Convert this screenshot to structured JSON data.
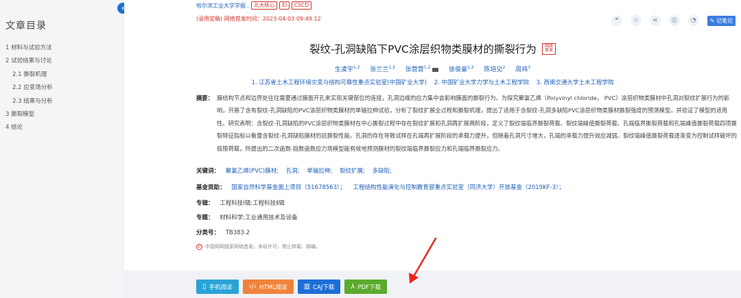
{
  "sidebar": {
    "title": "文章目录",
    "items": [
      {
        "label": "1 材料与试验方法",
        "level": 1
      },
      {
        "label": "2 试验结果与讨论",
        "level": 1
      },
      {
        "label": "2.1 撕裂机理",
        "level": 2
      },
      {
        "label": "2.2 应变场分析",
        "level": 2
      },
      {
        "label": "2.3 结果与分析",
        "level": 2
      },
      {
        "label": "3 撕裂模型",
        "level": 1
      },
      {
        "label": "4 结论",
        "level": 1
      }
    ],
    "collapse_icon": "chevron-left-icon"
  },
  "header": {
    "source": "哈尔滨工业大学学报 .",
    "badges": [
      "北大核心",
      "EI",
      "CSCD"
    ],
    "publish": "(录用定稿) 网络首发时间：2023-04-03 09:49:12",
    "tools": [
      "quote-icon",
      "star-icon",
      "share-icon",
      "print-icon",
      "bell-icon"
    ],
    "note_label": "记笔记"
  },
  "article": {
    "title": "裂纹-孔洞缺陷下PVC涂层织物类膜材的撕裂行为",
    "title_badge": "网络首发",
    "authors": [
      {
        "name": "生凌宇",
        "sup": "1,2"
      },
      {
        "name": "张兰兰",
        "sup": "1,2"
      },
      {
        "name": "张营营",
        "sup": "1,2"
      },
      {
        "name": "徐俊豪",
        "sup": "1,2"
      },
      {
        "name": "陈培见",
        "sup": "2"
      },
      {
        "name": "周祎",
        "sup": "3"
      }
    ],
    "affiliations": [
      "1. 江苏省土木工程环境灾变与结构可靠性重点实验室(中国矿业大学)",
      "2. 中国矿业大学力学与土木工程学院",
      "3. 西南交通大学土木工程学院"
    ],
    "abstract_label": "摘要：",
    "abstract": "膜结构节点和边界处往往需要通过膜面开孔来实现关键部位的连接，孔洞边缘的应力集中会影响膜面的撕裂行为。为探究聚氯乙烯（Polyvinyl chloride， PVC）涂层织物类膜材中孔洞对裂纹扩展行为的影响，开展了含有裂纹-孔洞缺陷的PVC涂层织物类膜材的单轴拉伸试验，分析了裂纹扩展全过程和撕裂机理，提出了适用于含裂纹-孔洞多缺陷PVC涂层织物类膜材撕裂强度的预测模型，并验证了模型的适用性。研究表明：含裂纹-孔洞缺陷的PVC涂层织物类膜材在中心撕裂过程中存在裂纹扩展和孔洞再扩展两阶段，定义了裂纹端临界撕裂荷载、裂纹端峰值撕裂荷载、孔端临界撕裂荷载和孔端峰值撕裂荷载四项撕裂特征指标以衡量含裂纹-孔洞缺陷膜材的抗撕裂性能。孔洞的存在导致试样在孔端再扩展阶段的承载力提升，但随着孔洞尺寸增大，孔端的承载力提升效应减弱。裂纹端峰值撕裂荷载逐渐变为控制试样破坏的极限荷载，所提出的二次函数-指数函数应力场模型能有效地预测膜材的裂纹端临界撕裂应力和孔端临界撕裂应力。",
    "keywords_label": "关键词：",
    "keywords": [
      "聚氯乙烯(PVC)膜材;",
      "孔洞;",
      "单轴拉伸;",
      "裂纹扩展;",
      "多缺陷;"
    ],
    "fund_label": "基金资助：",
    "funds": [
      "国家自然科学基金面上项目（51678563）；",
      "工程结构性能演化与控制教育部重点实验室（同济大学）开放基金（2019KF-3）；"
    ],
    "series_label": "专辑：",
    "series": "工程科技Ⅰ辑;工程科技Ⅱ辑",
    "topic_label": "专题：",
    "topic": "材料科学;工业通用技术及设备",
    "class_label": "分类号：",
    "class_no": "TB383.2",
    "notice": "中国知网独家网络首发，未经许可，禁止转载、摘编。"
  },
  "downloads": [
    {
      "label": "手机阅读",
      "icon": "phone-icon"
    },
    {
      "label": "HTML阅读",
      "icon": "code-icon"
    },
    {
      "label": "CAJ下载",
      "icon": "book-icon"
    },
    {
      "label": "PDF下载",
      "icon": "pdf-icon"
    }
  ],
  "colors": {
    "link": "#1d5fb5",
    "red": "#d0342c",
    "arrow": "#e8281e",
    "mobile": "#2aa3d6",
    "html": "#f0833a",
    "caj": "#1d6fd6",
    "pdf": "#5aab2b"
  }
}
